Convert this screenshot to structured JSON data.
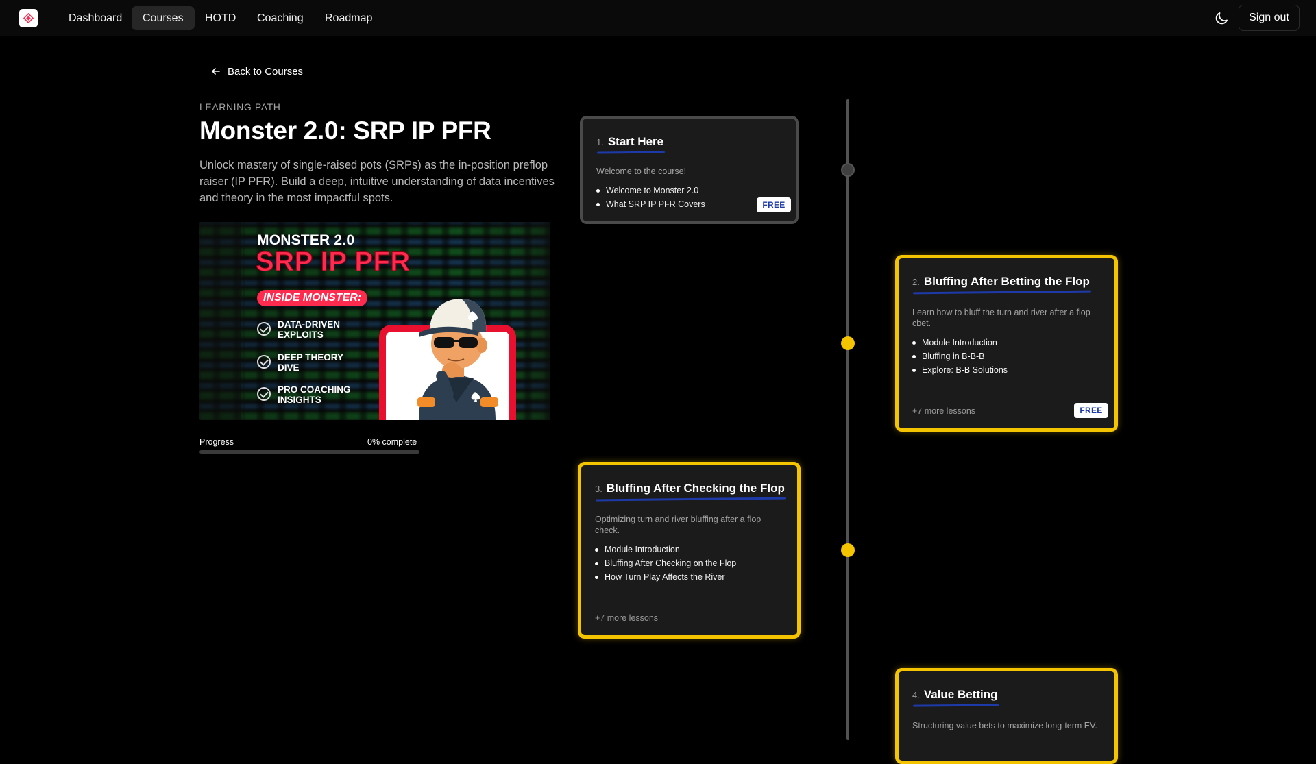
{
  "nav": {
    "links": [
      "Dashboard",
      "Courses",
      "HOTD",
      "Coaching",
      "Roadmap"
    ],
    "active": "Courses",
    "sign_out": "Sign out"
  },
  "header": {
    "back_label": "Back to Courses",
    "eyebrow": "LEARNING PATH",
    "title": "Monster 2.0: SRP IP PFR",
    "description": "Unlock mastery of single-raised pots (SRPs) as the in-position preflop raiser (IP PFR). Build a deep, intuitive understanding of data incentives and theory in the most impactful spots."
  },
  "hero": {
    "top_text": "MONSTER 2.0",
    "big_text": "SRP IP PFR",
    "pill": "INSIDE MONSTER:",
    "items": [
      "DATA-DRIVEN EXPLOITS",
      "DEEP THEORY DIVE",
      "PRO COACHING INSIGHTS"
    ]
  },
  "progress": {
    "label": "Progress",
    "percent_text": "0% complete",
    "value": 0
  },
  "modules": [
    {
      "number": "1.",
      "title": "Start Here",
      "description": "Welcome to the course!",
      "lessons": [
        "Welcome to Monster 2.0",
        "What SRP IP PFR Covers"
      ],
      "more": "",
      "badge": "FREE",
      "status": "default"
    },
    {
      "number": "2.",
      "title": "Bluffing After Betting the Flop",
      "description": "Learn how to bluff the turn and river after a flop cbet.",
      "lessons": [
        "Module Introduction",
        "Bluffing in B-B-B",
        "Explore: B-B Solutions"
      ],
      "more": "+7 more lessons",
      "badge": "FREE",
      "status": "highlighted"
    },
    {
      "number": "3.",
      "title": "Bluffing After Checking the Flop",
      "description": "Optimizing turn and river bluffing after a flop check.",
      "lessons": [
        "Module Introduction",
        "Bluffing After Checking on the Flop",
        "How Turn Play Affects the River"
      ],
      "more": "+7 more lessons",
      "badge": "",
      "status": "highlighted"
    },
    {
      "number": "4.",
      "title": "Value Betting",
      "description": "Structuring value bets to maximize long-term EV.",
      "lessons": [],
      "more": "",
      "badge": "",
      "status": "highlighted"
    }
  ],
  "colors": {
    "accent_gold": "#f5c400",
    "underline_blue": "#1d3aa8",
    "hero_red": "#ff2b4f"
  }
}
